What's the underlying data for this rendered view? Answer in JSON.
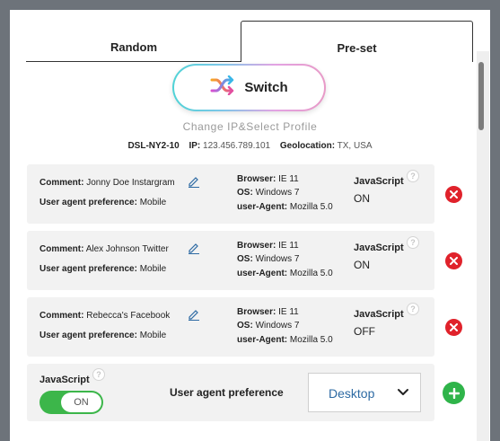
{
  "tabs": [
    {
      "label": "Random",
      "active": false
    },
    {
      "label": "Pre-set",
      "active": true
    }
  ],
  "switch_button": {
    "label": "Switch",
    "icon": "shuffle-icon"
  },
  "subtitle": "Change IP&Select Profile",
  "connection": {
    "server": "DSL-NY2-10",
    "ip_label": "IP:",
    "ip_value": "123.456.789.101",
    "geo_label": "Geolocation:",
    "geo_value": "TX, USA"
  },
  "labels": {
    "comment": "Comment:",
    "ua_pref": "User agent preference:",
    "browser": "Browser:",
    "os": "OS:",
    "user_agent": "user-Agent:",
    "javascript": "JavaScript",
    "help": "?"
  },
  "profiles": [
    {
      "comment": "Jonny Doe Instargram",
      "ua_pref": "Mobile",
      "browser": "IE 11",
      "os": "Windows 7",
      "user_agent": "Mozilla 5.0",
      "javascript": "ON"
    },
    {
      "comment": "Alex Johnson Twitter",
      "ua_pref": "Mobile",
      "browser": "IE 11",
      "os": "Windows 7",
      "user_agent": "Mozilla 5.0",
      "javascript": "ON"
    },
    {
      "comment": "Rebecca's Facebook",
      "ua_pref": "Mobile",
      "browser": "IE 11",
      "os": "Windows 7",
      "user_agent": "Mozilla 5.0",
      "javascript": "OFF"
    }
  ],
  "new_profile": {
    "javascript_label": "JavaScript",
    "toggle_value": "ON",
    "ua_label": "User agent preference",
    "ua_selected": "Desktop"
  },
  "colors": {
    "delete": "#e0222b",
    "add": "#2fb44a",
    "toggle_on": "#3cb64a",
    "select_text": "#2d6aa3"
  }
}
